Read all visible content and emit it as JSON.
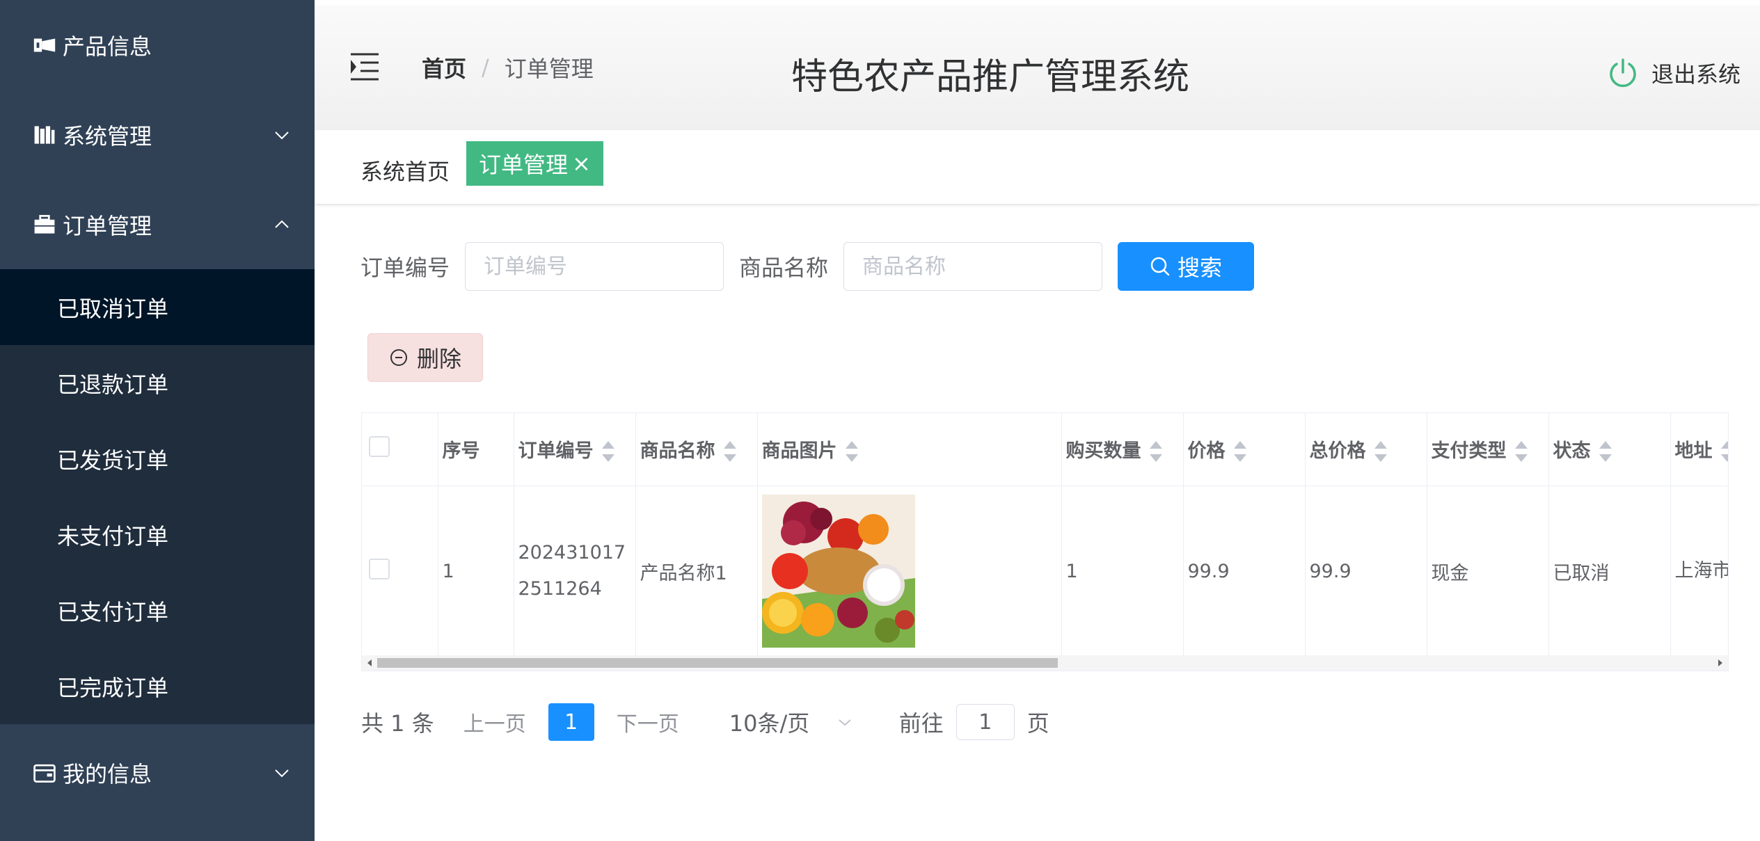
{
  "sidebar": {
    "items": [
      {
        "label": "产品信息",
        "icon": "product-icon"
      },
      {
        "label": "系统管理",
        "icon": "system-icon",
        "chevron": "down"
      },
      {
        "label": "订单管理",
        "icon": "briefcase-icon",
        "chevron": "up"
      },
      {
        "label": "我的信息",
        "icon": "wallet-icon",
        "chevron": "down"
      }
    ],
    "submenu": [
      {
        "label": "已取消订单",
        "active": true
      },
      {
        "label": "已退款订单"
      },
      {
        "label": "已发货订单"
      },
      {
        "label": "未支付订单"
      },
      {
        "label": "已支付订单"
      },
      {
        "label": "已完成订单"
      }
    ]
  },
  "header": {
    "breadcrumb_home": "首页",
    "breadcrumb_sep": "/",
    "breadcrumb_current": "订单管理",
    "title": "特色农产品推广管理系统",
    "logout_label": "退出系统"
  },
  "tags": {
    "home": "系统首页",
    "active": "订单管理",
    "close": "×"
  },
  "search": {
    "order_no_label": "订单编号",
    "order_no_placeholder": "订单编号",
    "product_name_label": "商品名称",
    "product_name_placeholder": "商品名称",
    "search_button": "搜索"
  },
  "toolbar": {
    "delete_button": "删除"
  },
  "table": {
    "columns": [
      "序号",
      "订单编号",
      "商品名称",
      "商品图片",
      "购买数量",
      "价格",
      "总价格",
      "支付类型",
      "状态",
      "地址"
    ],
    "rows": [
      {
        "index": "1",
        "order_no": "2024310172511264",
        "product_name": "产品名称1",
        "image": "fruit-basket",
        "quantity": "1",
        "price": "99.9",
        "total": "99.9",
        "pay_type": "现金",
        "status": "已取消",
        "address": "上海市区A栋"
      }
    ]
  },
  "pagination": {
    "total": "共 1 条",
    "prev": "上一页",
    "current": "1",
    "next": "下一页",
    "page_size": "10条/页",
    "goto_label": "前往",
    "goto_value": "1",
    "page_suffix": "页"
  },
  "colors": {
    "sidebar_bg": "#304156",
    "submenu_bg": "#1f2d3d",
    "submenu_active": "#001528",
    "tag_active": "#42b983",
    "primary": "#1890ff",
    "danger_light": "#f7e0e0"
  }
}
